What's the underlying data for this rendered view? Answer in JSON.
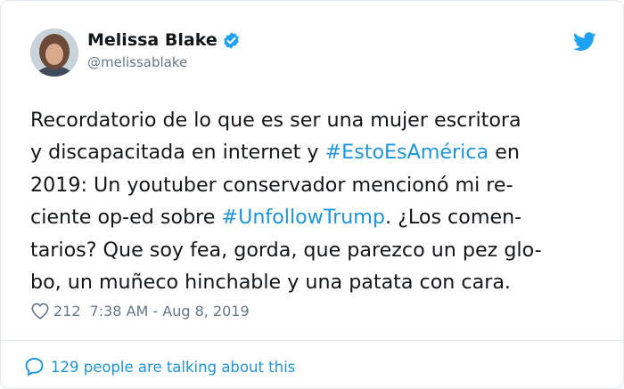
{
  "tweet": {
    "author": {
      "name": "Melissa Blake",
      "handle": "@melissablake",
      "verified": true
    },
    "lines": [
      [
        {
          "text": "Recordatorio de lo que es ser una mujer escritora"
        }
      ],
      [
        {
          "text": "y discapacitada en internet y "
        },
        {
          "text": "#EstoEsAmérica",
          "hashtag": true
        },
        {
          "text": " en"
        }
      ],
      [
        {
          "text": "2019: Un youtuber conservador mencionó mi re-"
        }
      ],
      [
        {
          "text": "ciente op-ed sobre "
        },
        {
          "text": "#UnfollowTrump",
          "hashtag": true
        },
        {
          "text": ".  ¿Los comen-"
        }
      ],
      [
        {
          "text": "tarios? Que soy fea, gorda, que parezco un pez glo-"
        }
      ],
      [
        {
          "text": "bo, un muñeco hinchable y una patata con cara."
        }
      ]
    ],
    "likes": "212",
    "timestamp": "7:38 AM - Aug 8, 2019",
    "footer": "129 people are talking about this"
  },
  "colors": {
    "accent": "#1b95e0",
    "muted": "#657786",
    "text": "#14171a",
    "border": "#e1e8ed"
  },
  "icons": {
    "verified": "verified-badge-icon",
    "platform": "twitter-bird-icon",
    "like": "heart-icon",
    "conversation": "speech-bubble-icon"
  }
}
